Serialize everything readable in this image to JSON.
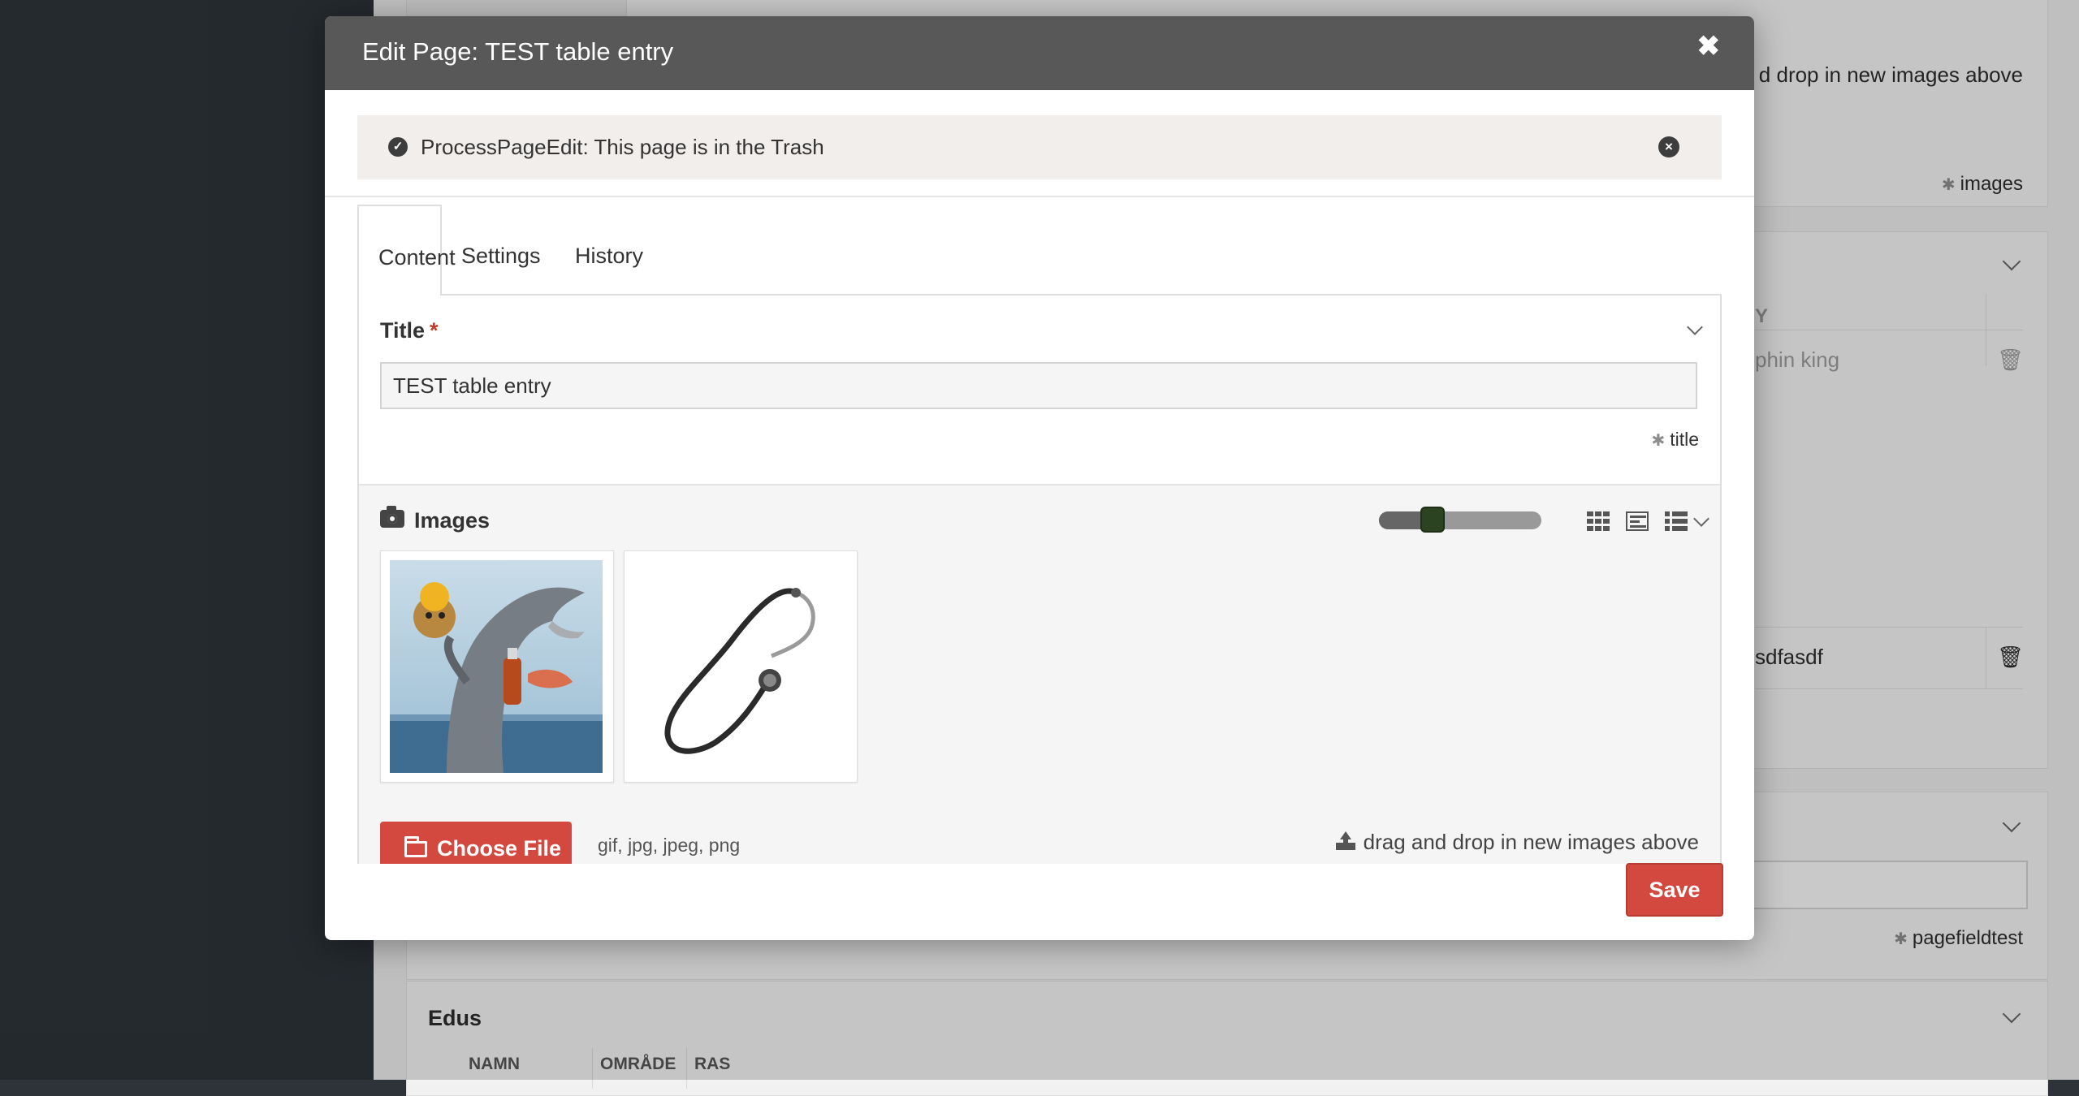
{
  "modal": {
    "title": "Edit Page: TEST table entry",
    "close_glyph": "✖",
    "notice": {
      "text": "ProcessPageEdit: This page is in the Trash",
      "check_icon": "check-circle-icon",
      "close_icon": "times-circle-icon"
    },
    "tabs": [
      {
        "label": "Content",
        "active": true
      },
      {
        "label": "Settings",
        "active": false
      },
      {
        "label": "History",
        "active": false
      }
    ],
    "title_field": {
      "label": "Title",
      "required_mark": "*",
      "value": "TEST table entry",
      "field_name": "title"
    },
    "images_field": {
      "label": "Images",
      "size_slider": 0.33,
      "images": [
        {
          "name": "dolphin-cat-image"
        },
        {
          "name": "stethoscope-image"
        }
      ],
      "choose_file_label": "Choose File",
      "extensions": "gif, jpg, jpeg, png",
      "drag_drop_text": "drag and drop in new images above"
    },
    "save_label": "Save"
  },
  "background": {
    "drag_drop_text": "d drop in new images above",
    "images_note": "images",
    "table_header": "Y",
    "row1": "phin king",
    "row2": "sdfasdf",
    "pagefield_note": "pagefieldtest",
    "edus_title": "Edus",
    "edus_columns": [
      "NAMN",
      "OMRÅDE",
      "RAS"
    ]
  },
  "colors": {
    "header_bg": "#585858",
    "accent_red": "#d4493f",
    "notice_bg": "#f2eeec",
    "sidebar_bg": "#2d3339"
  }
}
